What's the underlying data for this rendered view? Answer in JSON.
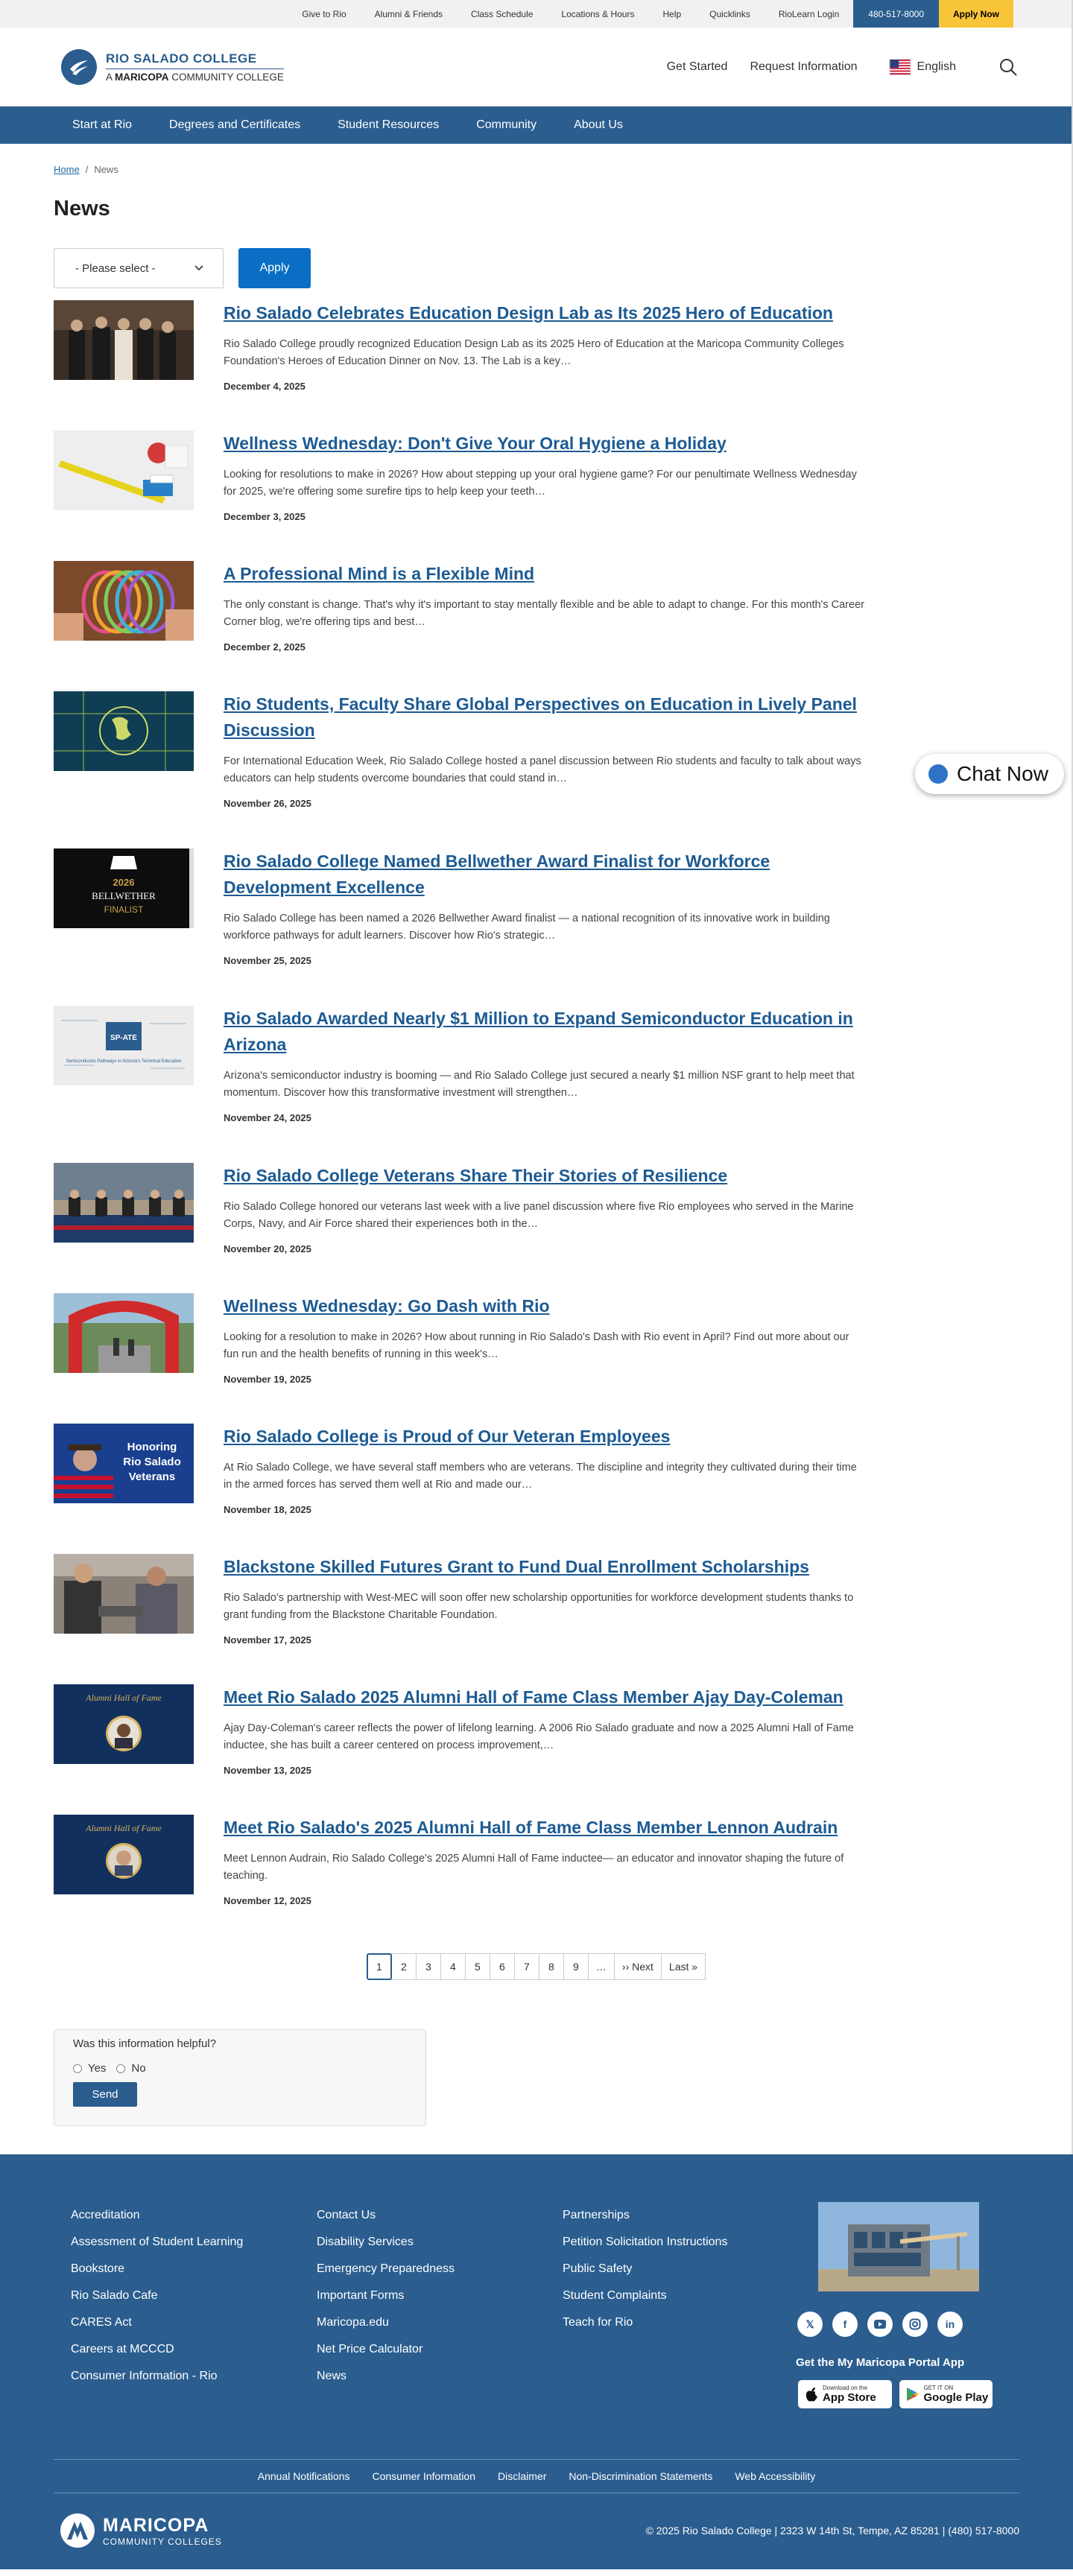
{
  "utility": {
    "links": [
      "Give to Rio",
      "Alumni & Friends",
      "Class Schedule",
      "Locations & Hours",
      "Help",
      "Quicklinks",
      "RioLearn Login"
    ],
    "phone": "480-517-8000",
    "apply": "Apply Now"
  },
  "header": {
    "logo_name": "RIO SALADO COLLEGE",
    "logo_sub_prefix": "A",
    "logo_sub_bold": "MARICOPA",
    "logo_sub_suffix": "COMMUNITY COLLEGE",
    "links": [
      "Get Started",
      "Request Information"
    ],
    "language": "English"
  },
  "nav": [
    "Start at Rio",
    "Degrees and Certificates",
    "Student Resources",
    "Community",
    "About Us"
  ],
  "breadcrumb": {
    "home": "Home",
    "separator": "/",
    "current": "News"
  },
  "page_title": "News",
  "filter": {
    "select_value": "- Please select -",
    "apply": "Apply"
  },
  "news": [
    {
      "title": "Rio Salado Celebrates Education Design Lab as Its 2025 Hero of Education",
      "excerpt": "Rio Salado College proudly recognized Education Design Lab as its 2025 Hero of Education at the Maricopa Community Colleges Foundation's Heroes of Education Dinner on Nov. 13. The Lab is a key…",
      "date": "December 4, 2025"
    },
    {
      "title": "Wellness Wednesday: Don't Give Your Oral Hygiene a Holiday",
      "excerpt": "Looking for resolutions to make in 2026? How about stepping up your oral hygiene game? For our penultimate Wellness Wednesday for 2025, we're offering some surefire tips to help keep your teeth…",
      "date": "December 3, 2025"
    },
    {
      "title": "A Professional Mind is a Flexible Mind",
      "excerpt": "The only constant is change. That's why it's important to stay mentally flexible and be able to adapt to change. For this month's Career Corner blog, we're offering tips and best…",
      "date": "December 2, 2025"
    },
    {
      "title": "Rio Students, Faculty Share Global Perspectives on Education in Lively Panel Discussion",
      "excerpt": "For International Education Week, Rio Salado College hosted a panel discussion between Rio students and faculty to talk about ways educators can help students overcome boundaries that could stand in…",
      "date": "November 26, 2025"
    },
    {
      "title": "Rio Salado College Named Bellwether Award Finalist for Workforce Development Excellence",
      "excerpt": "Rio Salado College has been named a 2026 Bellwether Award finalist — a national recognition of its innovative work in building workforce pathways for adult learners. Discover how Rio's strategic…",
      "date": "November 25, 2025"
    },
    {
      "title": "Rio Salado Awarded Nearly $1 Million to Expand Semiconductor Education in Arizona",
      "excerpt": "Arizona's semiconductor industry is booming — and Rio Salado College just secured a nearly $1 million NSF grant to help meet that momentum. Discover how this transformative investment will strengthen…",
      "date": "November 24, 2025"
    },
    {
      "title": "Rio Salado College Veterans Share Their Stories of Resilience",
      "excerpt": "Rio Salado College honored our veterans last week with a live panel discussion where five Rio employees who served in the Marine Corps, Navy, and Air Force shared their experiences both in the…",
      "date": "November 20, 2025"
    },
    {
      "title": "Wellness Wednesday: Go Dash with Rio",
      "excerpt": "Looking for a resolution to make in 2026? How about running in Rio Salado's Dash with Rio event in April? Find out more about our fun run and the health benefits of running in this week's…",
      "date": "November 19, 2025"
    },
    {
      "title": "Rio Salado College is Proud of Our Veteran Employees",
      "excerpt": "At Rio Salado College, we have several staff members who are veterans. The discipline and integrity they cultivated during their time in the armed forces has served them well at Rio and made our…",
      "date": "November 18, 2025"
    },
    {
      "title": "Blackstone Skilled Futures Grant to Fund Dual Enrollment Scholarships",
      "excerpt": "Rio Salado's partnership with West-MEC will soon offer new scholarship opportunities for workforce development students thanks to grant funding from the Blackstone Charitable Foundation.",
      "date": "November 17, 2025"
    },
    {
      "title": "Meet Rio Salado 2025 Alumni Hall of Fame Class Member Ajay Day-Coleman",
      "excerpt": "Ajay Day-Coleman's career reflects the power of lifelong learning. A 2006 Rio Salado graduate and now a 2025 Alumni Hall of Fame inductee, she has built a career centered on process improvement,…",
      "date": "November 13, 2025"
    },
    {
      "title": "Meet Rio Salado's 2025 Alumni Hall of Fame Class Member Lennon Audrain",
      "excerpt": "Meet Lennon Audrain, Rio Salado College's 2025 Alumni Hall of Fame inductee— an educator and innovator shaping the future of teaching.",
      "date": "November 12, 2025"
    }
  ],
  "thumb_text": {
    "bellwether_year": "2026",
    "bellwether_name": "BELLWETHER",
    "bellwether_finalist": "FINALIST",
    "spate_logo": "SP-ATE",
    "spate_caption": "Semiconductor Pathways in Arizona's Technical Education",
    "veteran_line1": "Honoring",
    "veteran_line2": "Rio Salado",
    "veteran_line3": "Veterans",
    "hall_of_fame": "Alumni Hall of Fame"
  },
  "pagination": [
    "1",
    "2",
    "3",
    "4",
    "5",
    "6",
    "7",
    "8",
    "9",
    "…",
    "›› Next",
    "Last »"
  ],
  "feedback": {
    "question": "Was this information helpful?",
    "yes": "Yes",
    "no": "No",
    "send": "Send"
  },
  "footer": {
    "col1": [
      "Accreditation",
      "Assessment of Student Learning",
      "Bookstore",
      "Rio Salado Cafe",
      "CARES Act",
      "Careers at MCCCD",
      "Consumer Information - Rio"
    ],
    "col2": [
      "Contact Us",
      "Disability Services",
      "Emergency Preparedness",
      "Important Forms",
      "Maricopa.edu",
      "Net Price Calculator",
      "News"
    ],
    "col3": [
      "Partnerships",
      "Petition Solicitation Instructions",
      "Public Safety",
      "Student Complaints",
      "Teach for Rio"
    ],
    "portal": "Get the My Maricopa Portal App",
    "appstore_small": "Download on the",
    "appstore_big": "App Store",
    "googleplay_small": "GET IT ON",
    "googleplay_big": "Google Play",
    "bar_links": [
      "Annual Notifications",
      "Consumer Information",
      "Disclaimer",
      "Non-Discrimination Statements",
      "Web Accessibility"
    ],
    "maricopa_name": "MARICOPA",
    "maricopa_sub": "COMMUNITY COLLEGES",
    "copyright": "© 2025 Rio Salado College | 2323 W 14th St, Tempe, AZ 85281 | (480) 517-8000"
  },
  "chat": {
    "label": "Chat Now"
  },
  "colors": {
    "brand_blue": "#2b5d8f",
    "link_blue": "#1d5b93",
    "apply_yellow": "#f8c43a",
    "button_blue": "#0a6ec4"
  }
}
